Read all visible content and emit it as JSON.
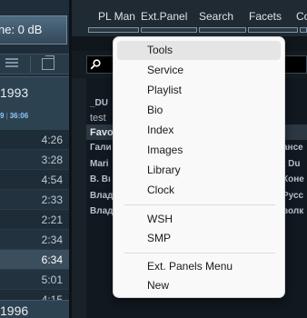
{
  "left_panel": {
    "volume_text": "ne: 0 dB",
    "album1": {
      "year": "1993",
      "count": "9",
      "duration": "36:06"
    },
    "tracks": [
      "4:26",
      "3:28",
      "4:54",
      "2:33",
      "2:21",
      "2:34",
      "6:34",
      "5:01",
      "4:15"
    ],
    "playing_index": 6,
    "album2": {
      "year": "1996"
    }
  },
  "tabs": [
    "PL Man",
    "Ext.Panel",
    "Search",
    "Facets",
    "Co"
  ],
  "content": {
    "lines": [
      "_DU",
      "test",
      "Favo",
      "Гали",
      "Mari",
      "B. Bı",
      "Влад",
      "Влад"
    ],
    "peeks": [
      "ансе",
      "t Du",
      "Коне",
      "Русс",
      "волк"
    ]
  },
  "menu": {
    "group1": [
      "Tools",
      "Service",
      "Playlist",
      "Bio",
      "Index",
      "Images",
      "Library",
      "Clock"
    ],
    "group2": [
      "WSH",
      "SMP"
    ],
    "group3": [
      "Ext. Panels Menu",
      "New"
    ],
    "highlighted": "Tools"
  },
  "colors": {
    "accent": "#8fc7ff",
    "panel_bg": "#1e2d39",
    "menu_bg": "#f9f9f9",
    "menu_highlight": "#e5e5e5"
  }
}
